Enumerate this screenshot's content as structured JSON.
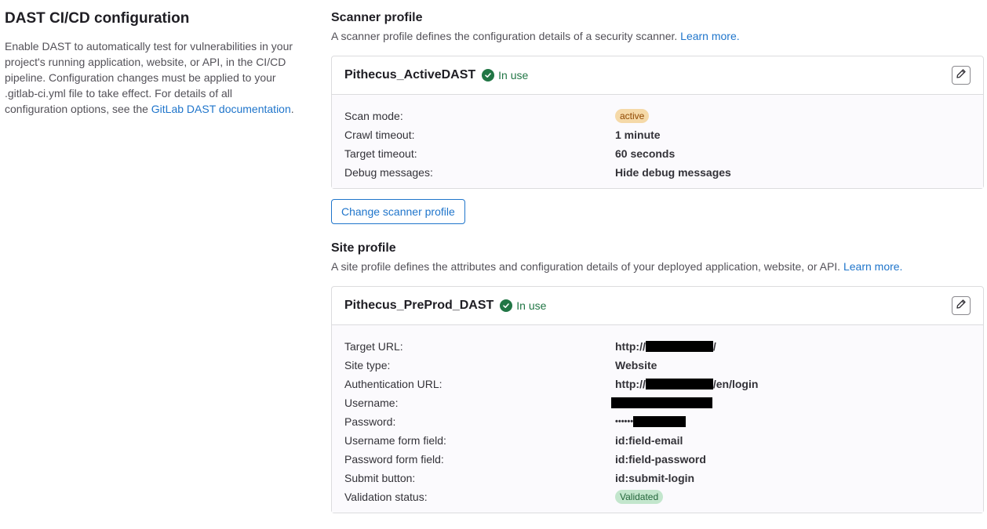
{
  "left": {
    "title": "DAST CI/CD configuration",
    "desc_part1": "Enable DAST to automatically test for vulnerabilities in your project's running application, website, or API, in the CI/CD pipeline. Configuration changes must be applied to your .gitlab-ci.yml file to take effect. For details of all configuration options, see the ",
    "desc_link": "GitLab DAST documentation",
    "desc_end": "."
  },
  "scanner": {
    "title": "Scanner profile",
    "desc": "A scanner profile defines the configuration details of a security scanner. ",
    "learn_more": "Learn more.",
    "profile_name": "Pithecus_ActiveDAST",
    "in_use": "In use",
    "rows": [
      {
        "label": "Scan mode:",
        "value": "active"
      },
      {
        "label": "Crawl timeout:",
        "value": "1 minute"
      },
      {
        "label": "Target timeout:",
        "value": "60 seconds"
      },
      {
        "label": "Debug messages:",
        "value": "Hide debug messages"
      }
    ],
    "change_button": "Change scanner profile"
  },
  "site": {
    "title": "Site profile",
    "desc": "A site profile defines the attributes and configuration details of your deployed application, website, or API. ",
    "learn_more": "Learn more.",
    "profile_name": "Pithecus_PreProd_DAST",
    "in_use": "In use",
    "target_url_prefix": "http://",
    "target_url_suffix": "/",
    "auth_url_prefix": "http://",
    "auth_url_suffix": "/en/login",
    "password_dots": "••••••",
    "rows": [
      {
        "label": "Target URL:"
      },
      {
        "label": "Site type:",
        "value": "Website"
      },
      {
        "label": "Authentication URL:"
      },
      {
        "label": "Username:"
      },
      {
        "label": "Password:"
      },
      {
        "label": "Username form field:",
        "value": "id:field-email"
      },
      {
        "label": "Password form field:",
        "value": "id:field-password"
      },
      {
        "label": "Submit button:",
        "value": "id:submit-login"
      },
      {
        "label": "Validation status:",
        "value": "Validated"
      }
    ]
  },
  "icons": {
    "check": "check-circle-icon",
    "edit": "pencil-icon"
  },
  "colors": {
    "link": "#1f75cb",
    "success": "#217645",
    "warning_badge": "#f5d9a8",
    "success_badge": "#c3e6cd"
  }
}
